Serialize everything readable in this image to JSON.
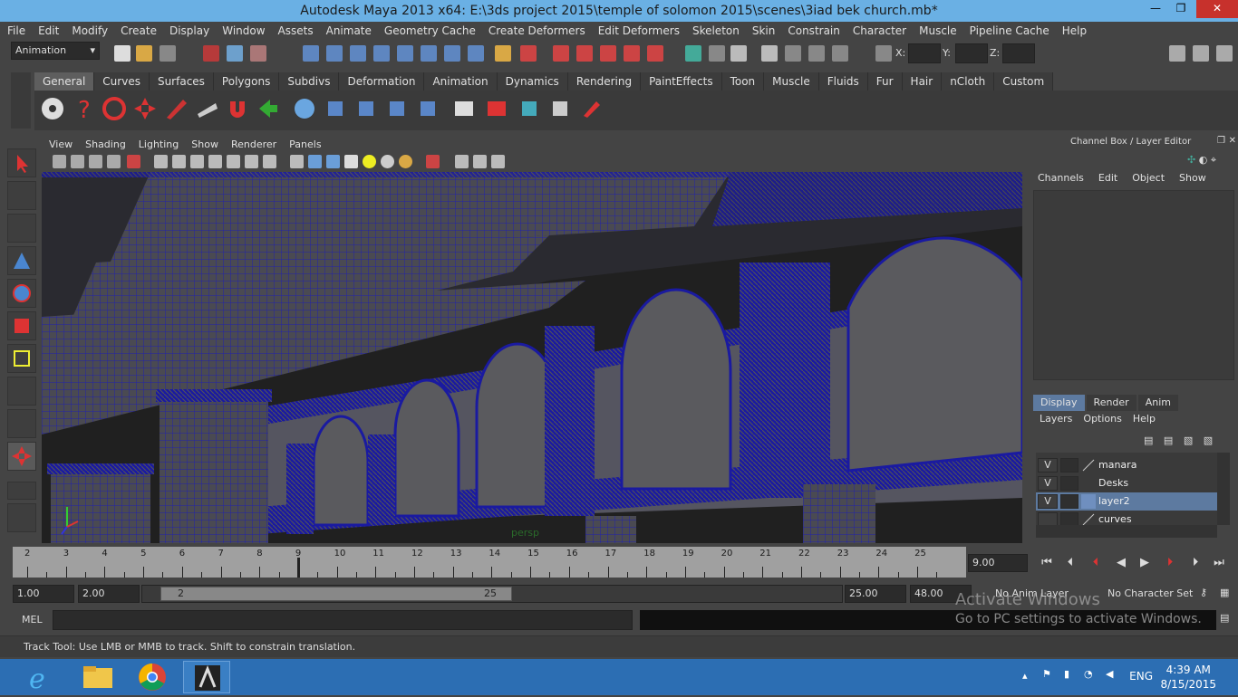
{
  "window": {
    "title": "Autodesk Maya 2013 x64: E:\\3ds project 2015\\temple of solomon 2015\\scenes\\3iad bek church.mb*"
  },
  "menubar": [
    "File",
    "Edit",
    "Modify",
    "Create",
    "Display",
    "Window",
    "Assets",
    "Animate",
    "Geometry Cache",
    "Create Deformers",
    "Edit Deformers",
    "Skeleton",
    "Skin",
    "Constrain",
    "Character",
    "Muscle",
    "Pipeline Cache",
    "Help"
  ],
  "statusline": {
    "menu_set": "Animation",
    "x_label": "X:",
    "y_label": "Y:",
    "z_label": "Z:"
  },
  "shelf": {
    "tabs": [
      "General",
      "Curves",
      "Surfaces",
      "Polygons",
      "Subdivs",
      "Deformation",
      "Animation",
      "Dynamics",
      "Rendering",
      "PaintEffects",
      "Toon",
      "Muscle",
      "Fluids",
      "Fur",
      "Hair",
      "nCloth",
      "Custom"
    ],
    "active_tab": "General"
  },
  "viewport": {
    "menu": [
      "View",
      "Shading",
      "Lighting",
      "Show",
      "Renderer",
      "Panels"
    ],
    "camera_label": "persp"
  },
  "channel_box": {
    "title": "Channel Box / Layer Editor",
    "menu": [
      "Channels",
      "Edit",
      "Object",
      "Show"
    ]
  },
  "layer_editor": {
    "tabs": [
      "Display",
      "Render",
      "Anim"
    ],
    "active_tab": "Display",
    "menu": [
      "Layers",
      "Options",
      "Help"
    ],
    "layers": [
      {
        "visible": "V",
        "name": "manara",
        "color": "",
        "selected": false
      },
      {
        "visible": "V",
        "name": "Desks",
        "color": "#3a3a3a",
        "selected": false
      },
      {
        "visible": "V",
        "name": "layer2",
        "color": "#6f8fbf",
        "selected": true
      },
      {
        "visible": "",
        "name": "curves",
        "color": "",
        "selected": false
      }
    ]
  },
  "timeline": {
    "ticks": [
      "2",
      "3",
      "4",
      "5",
      "6",
      "7",
      "8",
      "9",
      "10",
      "11",
      "12",
      "13",
      "14",
      "15",
      "16",
      "17",
      "18",
      "19",
      "20",
      "21",
      "22",
      "23",
      "24",
      "25"
    ],
    "current_frame": "9.00"
  },
  "range": {
    "start": "1.00",
    "playback_start": "2.00",
    "handle_start": "2",
    "handle_end": "25",
    "playback_end": "25.00",
    "end": "48.00",
    "anim_layer": "No Anim Layer",
    "character_set": "No Character Set"
  },
  "command_line": {
    "label": "MEL"
  },
  "help_line": "Track Tool: Use LMB or MMB to track. Shift to constrain translation.",
  "watermark": {
    "line1": "Activate Windows",
    "line2": "Go to PC settings to activate Windows."
  },
  "taskbar": {
    "language": "ENG",
    "time": "4:39 AM",
    "date": "8/15/2015"
  },
  "colors": {
    "titlebar": "#6ab0e4",
    "taskbar": "#2c6eb3",
    "wire": "#1f1fa8",
    "close": "#c7312c"
  }
}
